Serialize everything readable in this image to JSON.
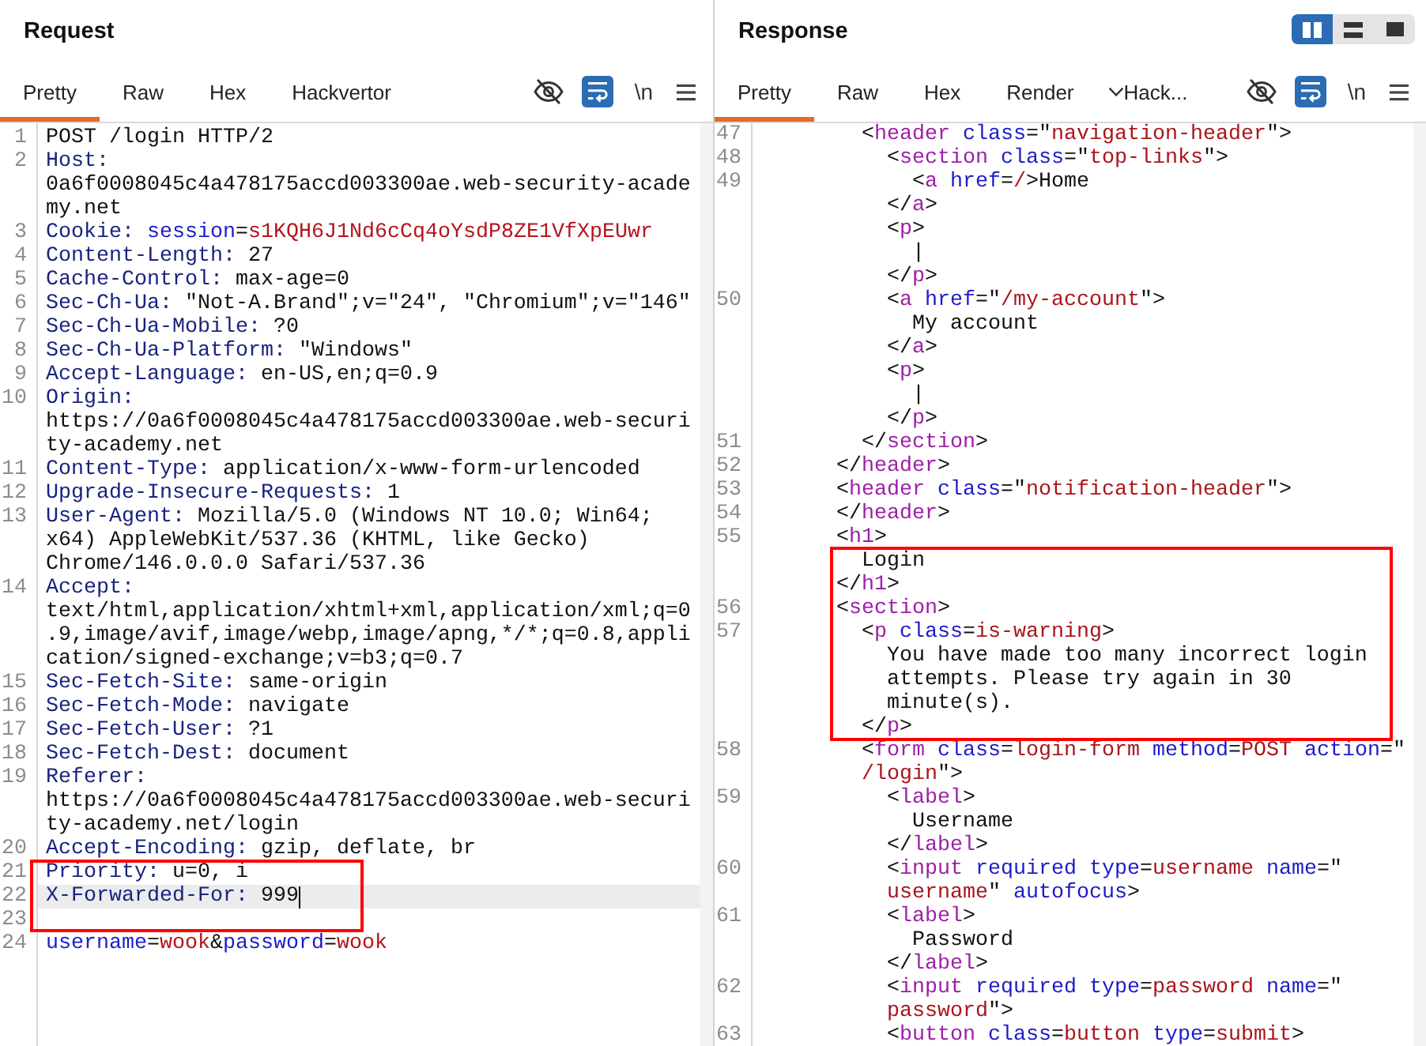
{
  "request": {
    "title": "Request",
    "tabs": [
      {
        "label": "Pretty",
        "kind": "tab",
        "selected": true
      },
      {
        "label": "Raw",
        "kind": "tab",
        "selected": false
      },
      {
        "label": "Hex",
        "kind": "tab",
        "selected": false
      },
      {
        "label": "Hackvertor",
        "kind": "tab",
        "selected": false
      }
    ],
    "toolbar": [
      {
        "kind": "eye",
        "on": false
      },
      {
        "kind": "wrap",
        "on": true
      },
      {
        "kind": "newline",
        "label": "\\n",
        "on": false
      },
      {
        "kind": "menu"
      }
    ],
    "lines": [
      {
        "number": "1",
        "current": false,
        "rows": [
          {
            "tokens": [
              {
                "kind": "plain",
                "text": "POST /login HTTP/2"
              }
            ]
          }
        ]
      },
      {
        "number": "2",
        "current": false,
        "rows": [
          {
            "tokens": [
              {
                "kind": "header",
                "text": "Host:"
              }
            ]
          },
          {
            "tokens": [
              {
                "kind": "plain",
                "text": "0a6f0008045c4a478175accd003300ae.web-security-acade"
              }
            ]
          },
          {
            "tokens": [
              {
                "kind": "plain",
                "text": "my.net"
              }
            ]
          }
        ]
      },
      {
        "number": "3",
        "current": false,
        "rows": [
          {
            "tokens": [
              {
                "kind": "header",
                "text": "Cookie: "
              },
              {
                "kind": "param",
                "text": "session"
              },
              {
                "kind": "plain",
                "text": "="
              },
              {
                "kind": "value",
                "text": "s1KQH6J1Nd6cCq4oYsdP8ZE1VfXpEUwr"
              }
            ]
          }
        ]
      },
      {
        "number": "4",
        "current": false,
        "rows": [
          {
            "tokens": [
              {
                "kind": "header",
                "text": "Content-Length:"
              },
              {
                "kind": "plain",
                "text": " 27"
              }
            ]
          }
        ]
      },
      {
        "number": "5",
        "current": false,
        "rows": [
          {
            "tokens": [
              {
                "kind": "header",
                "text": "Cache-Control:"
              },
              {
                "kind": "plain",
                "text": " max-age=0"
              }
            ]
          }
        ]
      },
      {
        "number": "6",
        "current": false,
        "rows": [
          {
            "tokens": [
              {
                "kind": "header",
                "text": "Sec-Ch-Ua:"
              },
              {
                "kind": "plain",
                "text": " \"Not-A.Brand\";v=\"24\", \"Chromium\";v=\"146\""
              }
            ]
          }
        ]
      },
      {
        "number": "7",
        "current": false,
        "rows": [
          {
            "tokens": [
              {
                "kind": "header",
                "text": "Sec-Ch-Ua-Mobile:"
              },
              {
                "kind": "plain",
                "text": " ?0"
              }
            ]
          }
        ]
      },
      {
        "number": "8",
        "current": false,
        "rows": [
          {
            "tokens": [
              {
                "kind": "header",
                "text": "Sec-Ch-Ua-Platform:"
              },
              {
                "kind": "plain",
                "text": " \"Windows\""
              }
            ]
          }
        ]
      },
      {
        "number": "9",
        "current": false,
        "rows": [
          {
            "tokens": [
              {
                "kind": "header",
                "text": "Accept-Language:"
              },
              {
                "kind": "plain",
                "text": " en-US,en;q=0.9"
              }
            ]
          }
        ]
      },
      {
        "number": "10",
        "current": false,
        "rows": [
          {
            "tokens": [
              {
                "kind": "header",
                "text": "Origin:"
              }
            ]
          },
          {
            "tokens": [
              {
                "kind": "plain",
                "text": "https://0a6f0008045c4a478175accd003300ae.web-securi"
              }
            ]
          },
          {
            "tokens": [
              {
                "kind": "plain",
                "text": "ty-academy.net"
              }
            ]
          }
        ]
      },
      {
        "number": "11",
        "current": false,
        "rows": [
          {
            "tokens": [
              {
                "kind": "header",
                "text": "Content-Type:"
              },
              {
                "kind": "plain",
                "text": " application/x-www-form-urlencoded"
              }
            ]
          }
        ]
      },
      {
        "number": "12",
        "current": false,
        "rows": [
          {
            "tokens": [
              {
                "kind": "header",
                "text": "Upgrade-Insecure-Requests:"
              },
              {
                "kind": "plain",
                "text": " 1"
              }
            ]
          }
        ]
      },
      {
        "number": "13",
        "current": false,
        "rows": [
          {
            "tokens": [
              {
                "kind": "header",
                "text": "User-Agent:"
              },
              {
                "kind": "plain",
                "text": " Mozilla/5.0 (Windows NT 10.0; Win64;"
              }
            ]
          },
          {
            "tokens": [
              {
                "kind": "plain",
                "text": "x64) AppleWebKit/537.36 (KHTML, like Gecko)"
              }
            ]
          },
          {
            "tokens": [
              {
                "kind": "plain",
                "text": "Chrome/146.0.0.0 Safari/537.36"
              }
            ]
          }
        ]
      },
      {
        "number": "14",
        "current": false,
        "rows": [
          {
            "tokens": [
              {
                "kind": "header",
                "text": "Accept:"
              }
            ]
          },
          {
            "tokens": [
              {
                "kind": "plain",
                "text": "text/html,application/xhtml+xml,application/xml;q=0"
              }
            ]
          },
          {
            "tokens": [
              {
                "kind": "plain",
                "text": ".9,image/avif,image/webp,image/apng,*/*;q=0.8,appli"
              }
            ]
          },
          {
            "tokens": [
              {
                "kind": "plain",
                "text": "cation/signed-exchange;v=b3;q=0.7"
              }
            ]
          }
        ]
      },
      {
        "number": "15",
        "current": false,
        "rows": [
          {
            "tokens": [
              {
                "kind": "header",
                "text": "Sec-Fetch-Site:"
              },
              {
                "kind": "plain",
                "text": " same-origin"
              }
            ]
          }
        ]
      },
      {
        "number": "16",
        "current": false,
        "rows": [
          {
            "tokens": [
              {
                "kind": "header",
                "text": "Sec-Fetch-Mode:"
              },
              {
                "kind": "plain",
                "text": " navigate"
              }
            ]
          }
        ]
      },
      {
        "number": "17",
        "current": false,
        "rows": [
          {
            "tokens": [
              {
                "kind": "header",
                "text": "Sec-Fetch-User:"
              },
              {
                "kind": "plain",
                "text": " ?1"
              }
            ]
          }
        ]
      },
      {
        "number": "18",
        "current": false,
        "rows": [
          {
            "tokens": [
              {
                "kind": "header",
                "text": "Sec-Fetch-Dest:"
              },
              {
                "kind": "plain",
                "text": " document"
              }
            ]
          }
        ]
      },
      {
        "number": "19",
        "current": false,
        "rows": [
          {
            "tokens": [
              {
                "kind": "header",
                "text": "Referer:"
              }
            ]
          },
          {
            "tokens": [
              {
                "kind": "plain",
                "text": "https://0a6f0008045c4a478175accd003300ae.web-securi"
              }
            ]
          },
          {
            "tokens": [
              {
                "kind": "plain",
                "text": "ty-academy.net/login"
              }
            ]
          }
        ]
      },
      {
        "number": "20",
        "current": false,
        "rows": [
          {
            "tokens": [
              {
                "kind": "header",
                "text": "Accept-Encoding:"
              },
              {
                "kind": "plain",
                "text": " gzip, deflate, br"
              }
            ]
          }
        ]
      },
      {
        "number": "21",
        "current": false,
        "rows": [
          {
            "tokens": [
              {
                "kind": "header",
                "text": "Priority:"
              },
              {
                "kind": "plain",
                "text": " u=0, i"
              }
            ]
          }
        ]
      },
      {
        "number": "22",
        "current": true,
        "rows": [
          {
            "tokens": [
              {
                "kind": "header",
                "text": "X-Forwarded-For:"
              },
              {
                "kind": "plain",
                "text": " 999"
              }
            ]
          }
        ]
      },
      {
        "number": "23",
        "current": false
      },
      {
        "number": "24",
        "current": false,
        "rows": [
          {
            "tokens": [
              {
                "kind": "param",
                "text": "username"
              },
              {
                "kind": "plain",
                "text": "="
              },
              {
                "kind": "value",
                "text": "wook"
              },
              {
                "kind": "plain",
                "text": "&"
              },
              {
                "kind": "param",
                "text": "password"
              },
              {
                "kind": "plain",
                "text": "="
              },
              {
                "kind": "value",
                "text": "wook"
              }
            ]
          }
        ]
      }
    ],
    "annotations": [
      {
        "kind": "rectangle"
      }
    ]
  },
  "response": {
    "title": "Response",
    "layout_buttons": [
      {
        "kind": "columns",
        "selected": true
      },
      {
        "kind": "rows",
        "selected": false
      },
      {
        "kind": "single",
        "selected": false
      }
    ],
    "tabs": [
      {
        "label": "Pretty",
        "kind": "tab",
        "selected": true
      },
      {
        "label": "Raw",
        "kind": "tab",
        "selected": false
      },
      {
        "label": "Hex",
        "kind": "tab",
        "selected": false
      },
      {
        "label": "Render",
        "kind": "tab",
        "selected": false
      },
      {
        "label": "Hack...",
        "kind": "dropdown",
        "selected": false
      }
    ],
    "toolbar": [
      {
        "kind": "eye",
        "on": false
      },
      {
        "kind": "wrap",
        "on": true
      },
      {
        "kind": "newline",
        "label": "\\n",
        "on": false
      },
      {
        "kind": "menu"
      }
    ],
    "lines": [
      {
        "number": "47",
        "rows": [
          {
            "tokens": [
              {
                "kind": "plain",
                "text": "        <"
              },
              {
                "kind": "tag",
                "text": "header"
              },
              {
                "kind": "attr",
                "text": " class"
              },
              {
                "kind": "plain",
                "text": "=\""
              },
              {
                "kind": "string",
                "text": "navigation-header"
              },
              {
                "kind": "plain",
                "text": "\">"
              }
            ]
          }
        ]
      },
      {
        "number": "48",
        "rows": [
          {
            "tokens": [
              {
                "kind": "plain",
                "text": "          <"
              },
              {
                "kind": "tag",
                "text": "section"
              },
              {
                "kind": "attr",
                "text": " class"
              },
              {
                "kind": "plain",
                "text": "=\""
              },
              {
                "kind": "string",
                "text": "top-links"
              },
              {
                "kind": "plain",
                "text": "\">"
              }
            ]
          }
        ]
      },
      {
        "number": "49",
        "rows": [
          {
            "tokens": [
              {
                "kind": "plain",
                "text": "            <"
              },
              {
                "kind": "tag",
                "text": "a"
              },
              {
                "kind": "attr",
                "text": " href"
              },
              {
                "kind": "plain",
                "text": "="
              },
              {
                "kind": "string",
                "text": "/"
              },
              {
                "kind": "plain",
                "text": ">Home"
              }
            ]
          },
          {
            "tokens": [
              {
                "kind": "plain",
                "text": "          </"
              },
              {
                "kind": "tag",
                "text": "a"
              },
              {
                "kind": "plain",
                "text": ">"
              }
            ]
          },
          {
            "tokens": [
              {
                "kind": "plain",
                "text": "          <"
              },
              {
                "kind": "tag",
                "text": "p"
              },
              {
                "kind": "plain",
                "text": ">"
              }
            ]
          },
          {
            "tokens": [
              {
                "kind": "plain",
                "text": "            |"
              }
            ]
          },
          {
            "tokens": [
              {
                "kind": "plain",
                "text": "          </"
              },
              {
                "kind": "tag",
                "text": "p"
              },
              {
                "kind": "plain",
                "text": ">"
              }
            ]
          }
        ]
      },
      {
        "number": "50",
        "rows": [
          {
            "tokens": [
              {
                "kind": "plain",
                "text": "          <"
              },
              {
                "kind": "tag",
                "text": "a"
              },
              {
                "kind": "attr",
                "text": " href"
              },
              {
                "kind": "plain",
                "text": "=\""
              },
              {
                "kind": "string",
                "text": "/my-account"
              },
              {
                "kind": "plain",
                "text": "\">"
              }
            ]
          },
          {
            "tokens": [
              {
                "kind": "plain",
                "text": "            My account"
              }
            ]
          },
          {
            "tokens": [
              {
                "kind": "plain",
                "text": "          </"
              },
              {
                "kind": "tag",
                "text": "a"
              },
              {
                "kind": "plain",
                "text": ">"
              }
            ]
          },
          {
            "tokens": [
              {
                "kind": "plain",
                "text": "          <"
              },
              {
                "kind": "tag",
                "text": "p"
              },
              {
                "kind": "plain",
                "text": ">"
              }
            ]
          },
          {
            "tokens": [
              {
                "kind": "plain",
                "text": "            |"
              }
            ]
          },
          {
            "tokens": [
              {
                "kind": "plain",
                "text": "          </"
              },
              {
                "kind": "tag",
                "text": "p"
              },
              {
                "kind": "plain",
                "text": ">"
              }
            ]
          }
        ]
      },
      {
        "number": "51",
        "rows": [
          {
            "tokens": [
              {
                "kind": "plain",
                "text": "        </"
              },
              {
                "kind": "tag",
                "text": "section"
              },
              {
                "kind": "plain",
                "text": ">"
              }
            ]
          }
        ]
      },
      {
        "number": "52",
        "rows": [
          {
            "tokens": [
              {
                "kind": "plain",
                "text": "      </"
              },
              {
                "kind": "tag",
                "text": "header"
              },
              {
                "kind": "plain",
                "text": ">"
              }
            ]
          }
        ]
      },
      {
        "number": "53",
        "rows": [
          {
            "tokens": [
              {
                "kind": "plain",
                "text": "      <"
              },
              {
                "kind": "tag",
                "text": "header"
              },
              {
                "kind": "attr",
                "text": " class"
              },
              {
                "kind": "plain",
                "text": "=\""
              },
              {
                "kind": "string",
                "text": "notification-header"
              },
              {
                "kind": "plain",
                "text": "\">"
              }
            ]
          }
        ]
      },
      {
        "number": "54",
        "rows": [
          {
            "tokens": [
              {
                "kind": "plain",
                "text": "      </"
              },
              {
                "kind": "tag",
                "text": "header"
              },
              {
                "kind": "plain",
                "text": ">"
              }
            ]
          }
        ]
      },
      {
        "number": "55",
        "rows": [
          {
            "tokens": [
              {
                "kind": "plain",
                "text": "      <"
              },
              {
                "kind": "tag",
                "text": "h1"
              },
              {
                "kind": "plain",
                "text": ">"
              }
            ]
          },
          {
            "tokens": [
              {
                "kind": "plain",
                "text": "        Login"
              }
            ]
          },
          {
            "tokens": [
              {
                "kind": "plain",
                "text": "      </"
              },
              {
                "kind": "tag",
                "text": "h1"
              },
              {
                "kind": "plain",
                "text": ">"
              }
            ]
          }
        ]
      },
      {
        "number": "56",
        "rows": [
          {
            "tokens": [
              {
                "kind": "plain",
                "text": "      <"
              },
              {
                "kind": "tag",
                "text": "section"
              },
              {
                "kind": "plain",
                "text": ">"
              }
            ]
          }
        ]
      },
      {
        "number": "57",
        "rows": [
          {
            "tokens": [
              {
                "kind": "plain",
                "text": "        <"
              },
              {
                "kind": "tag",
                "text": "p"
              },
              {
                "kind": "attr",
                "text": " class"
              },
              {
                "kind": "plain",
                "text": "="
              },
              {
                "kind": "string",
                "text": "is-warning"
              },
              {
                "kind": "plain",
                "text": ">"
              }
            ]
          },
          {
            "tokens": [
              {
                "kind": "plain",
                "text": "          You have made too many incorrect login"
              }
            ]
          },
          {
            "tokens": [
              {
                "kind": "plain",
                "text": "          attempts. Please try again in 30"
              }
            ]
          },
          {
            "tokens": [
              {
                "kind": "plain",
                "text": "          minute(s)."
              }
            ]
          },
          {
            "tokens": [
              {
                "kind": "plain",
                "text": "        </"
              },
              {
                "kind": "tag",
                "text": "p"
              },
              {
                "kind": "plain",
                "text": ">"
              }
            ]
          }
        ]
      },
      {
        "number": "58",
        "rows": [
          {
            "tokens": [
              {
                "kind": "plain",
                "text": "        <"
              },
              {
                "kind": "tag",
                "text": "form"
              },
              {
                "kind": "attr",
                "text": " class"
              },
              {
                "kind": "plain",
                "text": "="
              },
              {
                "kind": "string",
                "text": "login-form"
              },
              {
                "kind": "attr",
                "text": " method"
              },
              {
                "kind": "plain",
                "text": "="
              },
              {
                "kind": "string",
                "text": "POST"
              },
              {
                "kind": "attr",
                "text": " action"
              },
              {
                "kind": "plain",
                "text": "=\""
              }
            ]
          },
          {
            "tokens": [
              {
                "kind": "string",
                "text": "        /login"
              },
              {
                "kind": "plain",
                "text": "\">"
              }
            ]
          }
        ]
      },
      {
        "number": "59",
        "rows": [
          {
            "tokens": [
              {
                "kind": "plain",
                "text": "          <"
              },
              {
                "kind": "tag",
                "text": "label"
              },
              {
                "kind": "plain",
                "text": ">"
              }
            ]
          },
          {
            "tokens": [
              {
                "kind": "plain",
                "text": "            Username"
              }
            ]
          },
          {
            "tokens": [
              {
                "kind": "plain",
                "text": "          </"
              },
              {
                "kind": "tag",
                "text": "label"
              },
              {
                "kind": "plain",
                "text": ">"
              }
            ]
          }
        ]
      },
      {
        "number": "60",
        "rows": [
          {
            "tokens": [
              {
                "kind": "plain",
                "text": "          <"
              },
              {
                "kind": "tag",
                "text": "input"
              },
              {
                "kind": "attr",
                "text": " required type"
              },
              {
                "kind": "plain",
                "text": "="
              },
              {
                "kind": "string",
                "text": "username"
              },
              {
                "kind": "attr",
                "text": " name"
              },
              {
                "kind": "plain",
                "text": "=\""
              }
            ]
          },
          {
            "tokens": [
              {
                "kind": "string",
                "text": "          username"
              },
              {
                "kind": "plain",
                "text": "\" "
              },
              {
                "kind": "attr",
                "text": "autofocus"
              },
              {
                "kind": "plain",
                "text": ">"
              }
            ]
          }
        ]
      },
      {
        "number": "61",
        "rows": [
          {
            "tokens": [
              {
                "kind": "plain",
                "text": "          <"
              },
              {
                "kind": "tag",
                "text": "label"
              },
              {
                "kind": "plain",
                "text": ">"
              }
            ]
          },
          {
            "tokens": [
              {
                "kind": "plain",
                "text": "            Password"
              }
            ]
          },
          {
            "tokens": [
              {
                "kind": "plain",
                "text": "          </"
              },
              {
                "kind": "tag",
                "text": "label"
              },
              {
                "kind": "plain",
                "text": ">"
              }
            ]
          }
        ]
      },
      {
        "number": "62",
        "rows": [
          {
            "tokens": [
              {
                "kind": "plain",
                "text": "          <"
              },
              {
                "kind": "tag",
                "text": "input"
              },
              {
                "kind": "attr",
                "text": " required type"
              },
              {
                "kind": "plain",
                "text": "="
              },
              {
                "kind": "string",
                "text": "password"
              },
              {
                "kind": "attr",
                "text": " name"
              },
              {
                "kind": "plain",
                "text": "=\""
              }
            ]
          },
          {
            "tokens": [
              {
                "kind": "string",
                "text": "          password"
              },
              {
                "kind": "plain",
                "text": "\">"
              }
            ]
          }
        ]
      },
      {
        "number": "63",
        "rows": [
          {
            "tokens": [
              {
                "kind": "plain",
                "text": "          <"
              },
              {
                "kind": "tag",
                "text": "button"
              },
              {
                "kind": "attr",
                "text": " class"
              },
              {
                "kind": "plain",
                "text": "="
              },
              {
                "kind": "string",
                "text": "button"
              },
              {
                "kind": "attr",
                "text": " type"
              },
              {
                "kind": "plain",
                "text": "="
              },
              {
                "kind": "string",
                "text": "submit"
              },
              {
                "kind": "plain",
                "text": ">"
              }
            ]
          }
        ]
      }
    ],
    "annotations": [
      {
        "kind": "rectangle"
      }
    ]
  }
}
